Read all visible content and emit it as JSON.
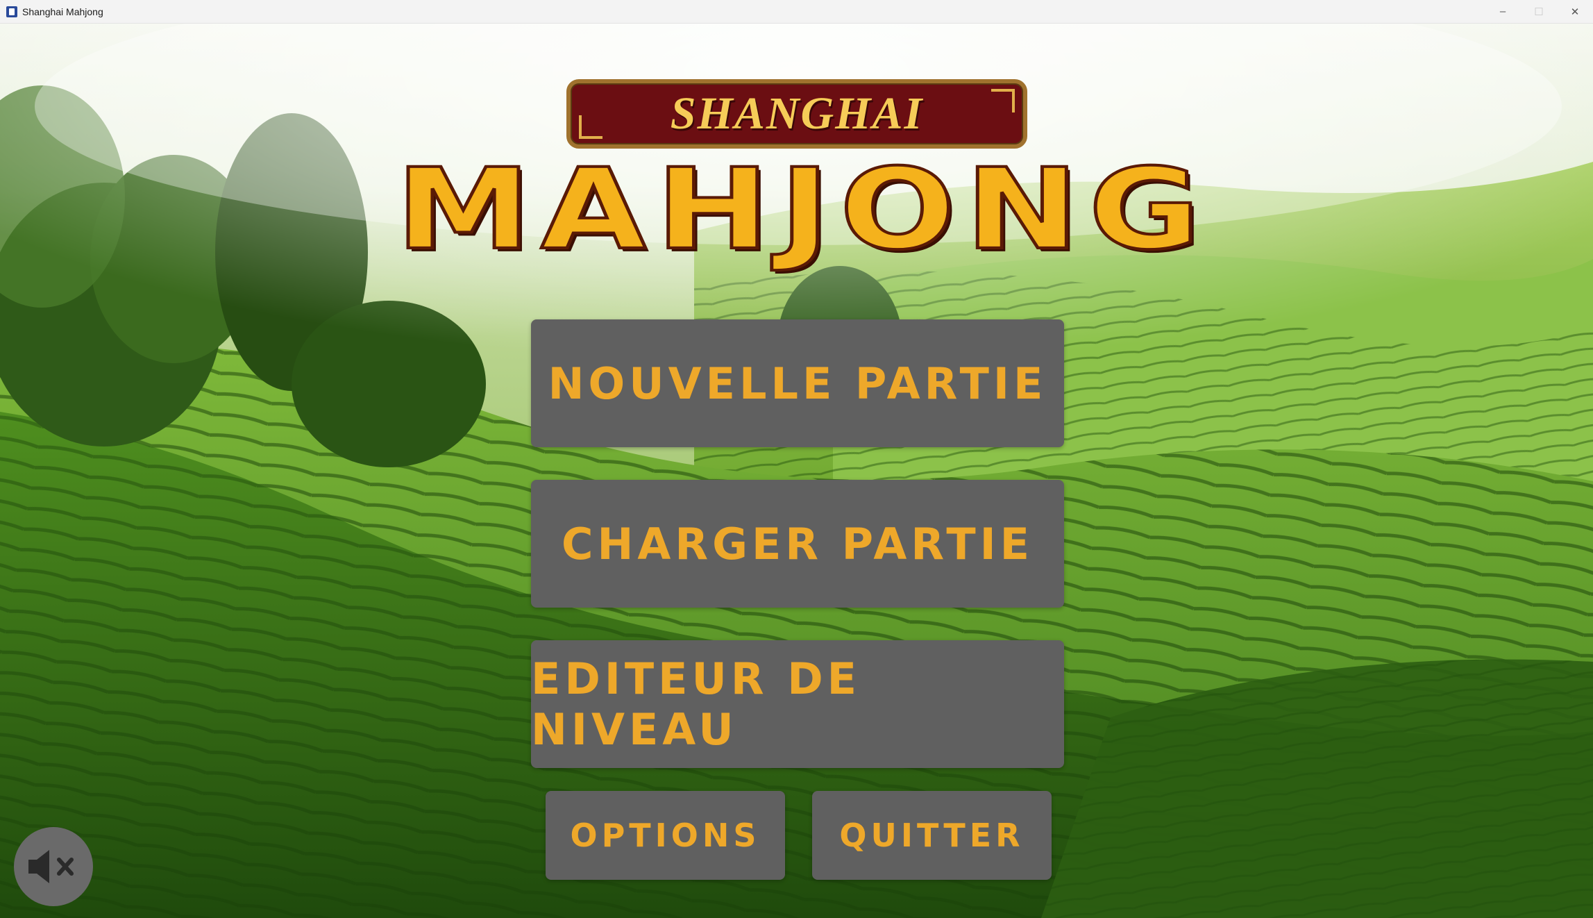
{
  "window": {
    "title": "Shanghai Mahjong",
    "controls": {
      "minimize": "–",
      "maximize": "☐",
      "close": "✕"
    }
  },
  "logo": {
    "shanghai": "SHANGHAI",
    "mahjong": "MAHJONG"
  },
  "menu": {
    "new_game": "NOUVELLE PARTIE",
    "load_game": "CHARGER PARTIE",
    "level_editor": "EDITEUR DE NIVEAU",
    "options": "OPTIONS",
    "quit": "QUITTER"
  },
  "sound": {
    "icon": "speaker-muted-icon",
    "muted": true
  },
  "colors": {
    "button_bg": "#606060",
    "button_text": "#eea82a",
    "logo_gold": "#f5b21c",
    "banner_red": "#6b0e12"
  },
  "background": {
    "icon": "tea-plantation-landscape"
  }
}
